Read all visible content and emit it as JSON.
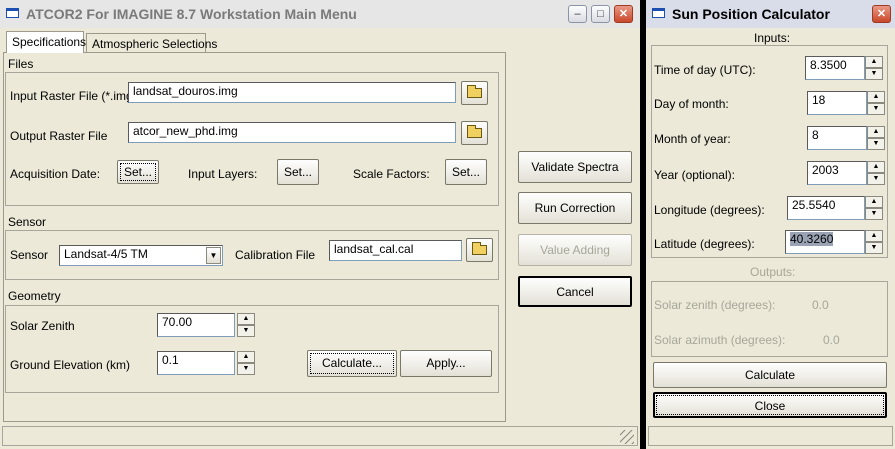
{
  "main_window": {
    "title": "ATCOR2 For IMAGINE 8.7 Workstation Main Menu",
    "tabs": [
      {
        "label": "Specifications",
        "active": true
      },
      {
        "label": "Atmospheric Selections",
        "active": false
      }
    ],
    "files": {
      "group_label": "Files",
      "input_raster_label": "Input Raster File (*.img)",
      "input_raster_value": "landsat_douros.img",
      "output_raster_label": "Output Raster File",
      "output_raster_value": "atcor_new_phd.img",
      "acquisition_date_label": "Acquisition Date:",
      "acquisition_set_label": "Set...",
      "input_layers_label": "Input Layers:",
      "input_layers_set_label": "Set...",
      "scale_factors_label": "Scale Factors:",
      "scale_factors_set_label": "Set..."
    },
    "sensor": {
      "group_label": "Sensor",
      "sensor_label": "Sensor",
      "sensor_value": "Landsat-4/5 TM",
      "calibration_label": "Calibration File",
      "calibration_value": "landsat_cal.cal"
    },
    "geometry": {
      "group_label": "Geometry",
      "solar_zenith_label": "Solar Zenith",
      "solar_zenith_value": "70.00",
      "ground_elevation_label": "Ground Elevation (km)",
      "ground_elevation_value": "0.1",
      "calculate_label": "Calculate...",
      "apply_label": "Apply..."
    },
    "actions": {
      "validate_label": "Validate Spectra",
      "run_label": "Run Correction",
      "value_adding_label": "Value Adding",
      "cancel_label": "Cancel"
    }
  },
  "sun_window": {
    "title": "Sun Position Calculator",
    "inputs_label": "Inputs:",
    "fields": [
      {
        "label": "Time of day (UTC):",
        "value": "8.3500"
      },
      {
        "label": "Day of month:",
        "value": "18"
      },
      {
        "label": "Month of year:",
        "value": "8"
      },
      {
        "label": "Year (optional):",
        "value": "2003"
      },
      {
        "label": "Longitude (degrees):",
        "value": "25.5540"
      },
      {
        "label": "Latitude (degrees):",
        "value": "40.3260"
      }
    ],
    "outputs_label": "Outputs:",
    "outputs": [
      {
        "label": "Solar zenith (degrees):",
        "value": "0.0"
      },
      {
        "label": "Solar azimuth (degrees):",
        "value": "0.0"
      }
    ],
    "calculate_label": "Calculate",
    "close_label": "Close"
  },
  "icons": [
    "window-icon",
    "minimize-icon",
    "maximize-icon",
    "close-icon",
    "folder-open-icon",
    "spin-up-icon",
    "spin-down-icon",
    "dropdown-arrow-icon",
    "resize-grip-icon"
  ]
}
